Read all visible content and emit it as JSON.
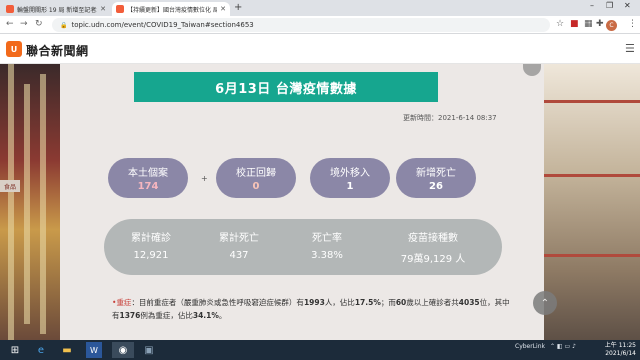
{
  "browser": {
    "tabs": [
      {
        "title": "輪盤開關形 19 局 新增至記者本次",
        "color": "#f25d3a"
      },
      {
        "title": "【持續更新】國台灣疫情數位化 局",
        "color": "#f25d3a"
      }
    ],
    "new_tab_symbol": "+",
    "url": "topic.udn.com/event/COVID19_Taiwan#section4653"
  },
  "site": {
    "logo_char": "U",
    "brand": "聯合新聞網"
  },
  "article": {
    "banner": "6月13日 台灣疫情數據",
    "updated": "更新時間：2021-6-14  08:37",
    "cases": [
      {
        "label": "本土個案",
        "value": "174"
      },
      {
        "label": "校正回歸",
        "value": "0"
      },
      {
        "label": "境外移入",
        "value": "1"
      },
      {
        "label": "新增死亡",
        "value": "26"
      }
    ],
    "plus": "+",
    "stats": [
      {
        "label": "累計確診",
        "value": "12,921"
      },
      {
        "label": "累計死亡",
        "value": "437"
      },
      {
        "label": "死亡率",
        "value": "3.38%"
      },
      {
        "label": "疫苗接種數",
        "value": "79萬9,129 人"
      }
    ],
    "note": {
      "bullet": "•",
      "keyword": "重症",
      "line_a": "：目前重症者（嚴重肺炎或急性呼吸窘迫症候群）有",
      "n1": "1993",
      "line_b": "人，佔比",
      "p1": "17.5%",
      "line_c": "；而",
      "age": "60",
      "line_d": "歲以上確診者共",
      "n2": "4035",
      "line_e": "位，其中有",
      "n3": "1376",
      "line_f": "例為重症，佔比",
      "p2": "34.1%",
      "line_g": "。"
    },
    "side_sign": "食品"
  },
  "taskbar": {
    "tray_label": "CyberLink",
    "time": "上午 11:25",
    "date": "2021/6/14"
  }
}
